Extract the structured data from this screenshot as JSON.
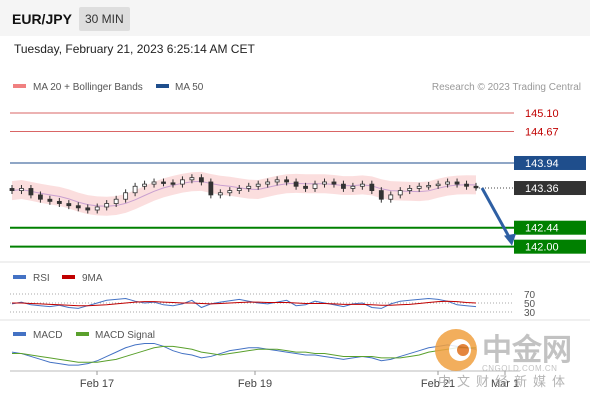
{
  "header": {
    "pair": "EUR/JPY",
    "timeframe": "30 MIN"
  },
  "datetime": "Tuesday, February 21, 2023 6:25:14 AM CET",
  "legend": {
    "ma20": "MA 20 + Bollinger Bands",
    "ma50": "MA 50",
    "credit": "Research © 2023 Trading Central"
  },
  "colors": {
    "resistance": "#c00000",
    "support": "#008000",
    "ma50": "#1f4e8c",
    "ma20": "#f08080",
    "bollinger": "#f9d0d0",
    "arrow": "#2e5fa3",
    "current": "#333333"
  },
  "chart_data": [
    {
      "type": "candlestick",
      "title": "",
      "x_tick_labels": [
        "Feb 17",
        "Feb 19",
        "Feb 21",
        "Mar 1"
      ],
      "ylim": [
        141.9,
        145.4
      ],
      "current_price": 143.36,
      "levels": [
        {
          "value": 145.1,
          "role": "resistance",
          "label": "145.10"
        },
        {
          "value": 144.67,
          "role": "resistance",
          "label": "144.67"
        },
        {
          "value": 143.94,
          "role": "pivot",
          "label": "143.94"
        },
        {
          "value": 143.36,
          "role": "last",
          "label": "143.36"
        },
        {
          "value": 142.44,
          "role": "support",
          "label": "142.44"
        },
        {
          "value": 142.0,
          "role": "support",
          "label": "142.00"
        }
      ],
      "close": [
        143.3,
        143.35,
        143.2,
        143.1,
        143.05,
        143.0,
        142.95,
        142.9,
        142.85,
        142.92,
        143.0,
        143.1,
        143.25,
        143.4,
        143.45,
        143.5,
        143.48,
        143.45,
        143.55,
        143.6,
        143.5,
        143.2,
        143.25,
        143.3,
        143.35,
        143.4,
        143.45,
        143.5,
        143.55,
        143.5,
        143.4,
        143.35,
        143.45,
        143.5,
        143.45,
        143.35,
        143.4,
        143.45,
        143.3,
        143.1,
        143.2,
        143.3,
        143.35,
        143.4,
        143.42,
        143.45,
        143.5,
        143.45,
        143.4,
        143.38
      ],
      "projection": {
        "from": 143.36,
        "to": 142.0
      }
    },
    {
      "type": "line",
      "legend": [
        "RSI",
        "9MA"
      ],
      "y_tick_labels": [
        "70",
        "50",
        "30"
      ],
      "series": [
        {
          "name": "RSI",
          "values": [
            48,
            52,
            46,
            44,
            42,
            45,
            40,
            38,
            44,
            50,
            56,
            58,
            60,
            54,
            50,
            52,
            46,
            44,
            48,
            56,
            40,
            48,
            52,
            55,
            58,
            54,
            50,
            48,
            52,
            56,
            44,
            46,
            54,
            50,
            46,
            42,
            48,
            50,
            40,
            38,
            48,
            54,
            56,
            58,
            60,
            58,
            54,
            46,
            44,
            42
          ]
        },
        {
          "name": "9MA",
          "values": [
            50,
            50,
            49,
            48,
            47,
            46,
            45,
            44,
            44,
            45,
            46,
            48,
            50,
            52,
            53,
            53,
            52,
            51,
            50,
            50,
            49,
            48,
            49,
            50,
            51,
            52,
            52,
            51,
            51,
            51,
            50,
            49,
            49,
            49,
            48,
            47,
            47,
            47,
            46,
            45,
            45,
            46,
            47,
            49,
            51,
            53,
            54,
            53,
            51,
            50
          ]
        }
      ]
    },
    {
      "type": "line",
      "legend": [
        "MACD",
        "MACD Signal"
      ],
      "series": [
        {
          "name": "MACD",
          "values": [
            2,
            1,
            -1,
            -3,
            -5,
            -6,
            -7,
            -7,
            -6,
            -4,
            -1,
            2,
            5,
            7,
            8,
            8,
            6,
            3,
            1,
            0,
            -2,
            -1,
            1,
            3,
            4,
            5,
            5,
            4,
            3,
            2,
            1,
            0,
            0,
            -1,
            -2,
            -3,
            -2,
            -1,
            -2,
            -4,
            -3,
            -1,
            1,
            3,
            5,
            6,
            7,
            6,
            5,
            4
          ]
        },
        {
          "name": "MACD Signal",
          "values": [
            1,
            1,
            0,
            -1,
            -2,
            -3,
            -4,
            -5,
            -5,
            -5,
            -4,
            -3,
            -1,
            1,
            3,
            5,
            6,
            6,
            5,
            4,
            2,
            1,
            0,
            1,
            2,
            3,
            4,
            4,
            4,
            3,
            2,
            2,
            1,
            1,
            0,
            -1,
            -1,
            -1,
            -1,
            -2,
            -2,
            -2,
            -1,
            0,
            2,
            3,
            4,
            5,
            5,
            5
          ]
        }
      ]
    }
  ],
  "watermark": {
    "brand": "中金网",
    "domain": "CNGOLD.COM.CN",
    "tagline": "中文财经新媒体"
  }
}
